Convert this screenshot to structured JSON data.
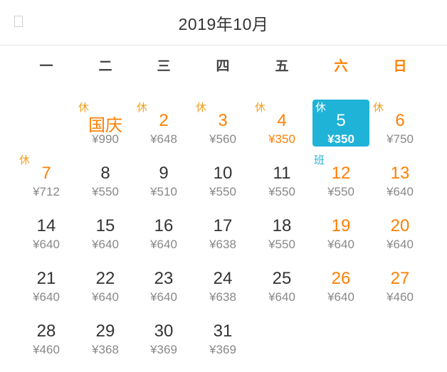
{
  "header": {
    "title": "2019年10月"
  },
  "weekdays": [
    "一",
    "二",
    "三",
    "四",
    "五",
    "六",
    "日"
  ],
  "colors": {
    "accent": "#1fb3d7",
    "holiday": "#ff7f00",
    "text": "#333333",
    "muted": "#888888"
  },
  "days": [
    {
      "label": "国庆",
      "price": "¥990",
      "tag": "休"
    },
    {
      "label": "2",
      "price": "¥648",
      "tag": "休"
    },
    {
      "label": "3",
      "price": "¥560",
      "tag": "休"
    },
    {
      "label": "4",
      "price": "¥350",
      "tag": "休",
      "low": true
    },
    {
      "label": "5",
      "price": "¥350",
      "tag": "休",
      "selected": true
    },
    {
      "label": "6",
      "price": "¥750",
      "tag": "休"
    },
    {
      "label": "7",
      "price": "¥712",
      "tag": "休"
    },
    {
      "label": "8",
      "price": "¥550"
    },
    {
      "label": "9",
      "price": "¥510"
    },
    {
      "label": "10",
      "price": "¥550"
    },
    {
      "label": "11",
      "price": "¥550"
    },
    {
      "label": "12",
      "price": "¥550",
      "tag": "班"
    },
    {
      "label": "13",
      "price": "¥640"
    },
    {
      "label": "14",
      "price": "¥640"
    },
    {
      "label": "15",
      "price": "¥640"
    },
    {
      "label": "16",
      "price": "¥640"
    },
    {
      "label": "17",
      "price": "¥638"
    },
    {
      "label": "18",
      "price": "¥550"
    },
    {
      "label": "19",
      "price": "¥640"
    },
    {
      "label": "20",
      "price": "¥640"
    },
    {
      "label": "21",
      "price": "¥640"
    },
    {
      "label": "22",
      "price": "¥640"
    },
    {
      "label": "23",
      "price": "¥640"
    },
    {
      "label": "24",
      "price": "¥638"
    },
    {
      "label": "25",
      "price": "¥640"
    },
    {
      "label": "26",
      "price": "¥640"
    },
    {
      "label": "27",
      "price": "¥460"
    },
    {
      "label": "28",
      "price": "¥460"
    },
    {
      "label": "29",
      "price": "¥368"
    },
    {
      "label": "30",
      "price": "¥369"
    },
    {
      "label": "31",
      "price": "¥369"
    }
  ]
}
